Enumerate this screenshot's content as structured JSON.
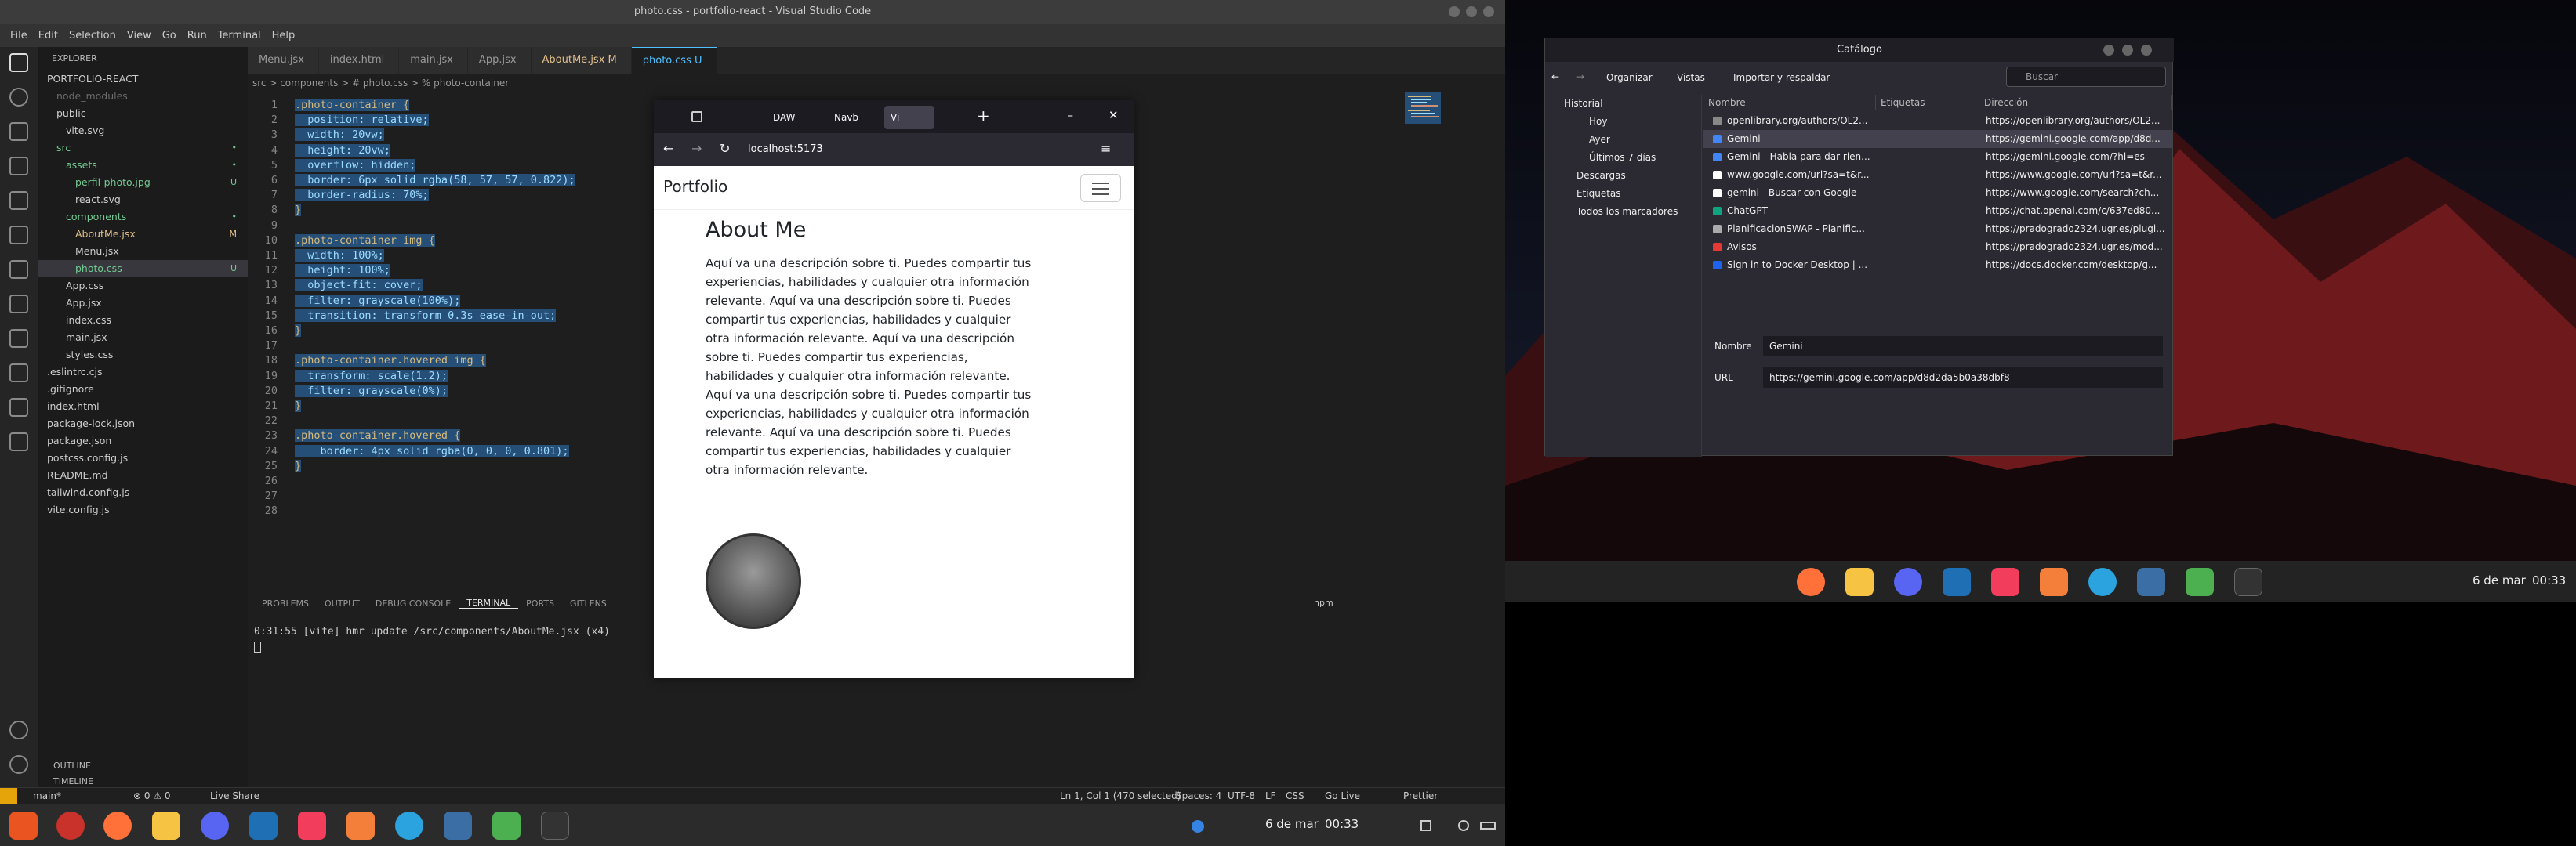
{
  "vscode": {
    "title": "photo.css - portfolio-react - Visual Studio Code",
    "menu": [
      "File",
      "Edit",
      "Selection",
      "View",
      "Go",
      "Run",
      "Terminal",
      "Help"
    ],
    "explorer_header": "EXPLORER",
    "tree": [
      {
        "label": "PORTFOLIO-REACT",
        "badge": "",
        "color": "#cccccc"
      },
      {
        "label": "node_modules",
        "badge": "",
        "color": "#6b6b6b"
      },
      {
        "label": "public",
        "badge": "",
        "color": "#cccccc"
      },
      {
        "label": "vite.svg",
        "badge": "",
        "color": "#cccccc"
      },
      {
        "label": "src",
        "badge": "•",
        "color": "#73c991"
      },
      {
        "label": "assets",
        "badge": "•",
        "color": "#73c991"
      },
      {
        "label": "perfil-photo.jpg",
        "badge": "U",
        "color": "#73c991"
      },
      {
        "label": "react.svg",
        "badge": "",
        "color": "#cccccc"
      },
      {
        "label": "components",
        "badge": "•",
        "color": "#73c991"
      },
      {
        "label": "AboutMe.jsx",
        "badge": "M",
        "color": "#e2c08d"
      },
      {
        "label": "Menu.jsx",
        "badge": "",
        "color": "#cccccc"
      },
      {
        "label": "photo.css",
        "badge": "U",
        "color": "#73c991"
      },
      {
        "label": "App.css",
        "badge": "",
        "color": "#cccccc"
      },
      {
        "label": "App.jsx",
        "badge": "",
        "color": "#cccccc"
      },
      {
        "label": "index.css",
        "badge": "",
        "color": "#cccccc"
      },
      {
        "label": "main.jsx",
        "badge": "",
        "color": "#cccccc"
      },
      {
        "label": "styles.css",
        "badge": "",
        "color": "#cccccc"
      },
      {
        "label": ".eslintrc.cjs",
        "badge": "",
        "color": "#cccccc"
      },
      {
        "label": ".gitignore",
        "badge": "",
        "color": "#cccccc"
      },
      {
        "label": "index.html",
        "badge": "",
        "color": "#cccccc"
      },
      {
        "label": "package-lock.json",
        "badge": "",
        "color": "#cccccc"
      },
      {
        "label": "package.json",
        "badge": "",
        "color": "#cccccc"
      },
      {
        "label": "postcss.config.js",
        "badge": "",
        "color": "#cccccc"
      },
      {
        "label": "README.md",
        "badge": "",
        "color": "#cccccc"
      },
      {
        "label": "tailwind.config.js",
        "badge": "",
        "color": "#cccccc"
      },
      {
        "label": "vite.config.js",
        "badge": "",
        "color": "#cccccc"
      }
    ],
    "tabs": [
      "Menu.jsx",
      "index.html",
      "main.jsx",
      "App.jsx",
      "AboutMe.jsx M",
      "photo.css U"
    ],
    "breadcrumb": "src > components > # photo.css > % photo-container",
    "code_lines": [
      ".photo-container {",
      "  position: relative;",
      "  width: 20vw;",
      "  height: 20vw;",
      "  overflow: hidden;",
      "  border: 6px solid rgba(58, 57, 57, 0.822);",
      "  border-radius: 70%;",
      "}",
      "",
      ".photo-container img {",
      "  width: 100%;",
      "  height: 100%;",
      "  object-fit: cover;",
      "  filter: grayscale(100%);",
      "  transition: transform 0.3s ease-in-out;",
      "}",
      "",
      ".photo-container.hovered img {",
      "  transform: scale(1.2);",
      "  filter: grayscale(0%);",
      "}",
      "",
      ".photo-container.hovered {",
      "    border: 4px solid rgba(0, 0, 0, 0.801);",
      "}",
      "",
      "",
      ""
    ],
    "panel_tabs": [
      "PROBLEMS",
      "OUTPUT",
      "DEBUG CONSOLE",
      "TERMINAL",
      "PORTS",
      "GITLENS"
    ],
    "panel_shell": "npm",
    "terminal_line": "0:31:55 [vite] hmr update /src/components/AboutMe.jsx (x4)",
    "outline": "OUTLINE",
    "timeline": "TIMELINE",
    "status": {
      "branch": "main*",
      "errors": "⊗ 0 ⚠ 0",
      "live_share": "Live Share",
      "position": "Ln 1, Col 1 (470 selected)",
      "spaces": "Spaces: 4",
      "encoding": "UTF-8",
      "eol": "LF",
      "language": "CSS",
      "go_live": "Go Live",
      "prettier": "Prettier"
    }
  },
  "firefox": {
    "tabs": [
      "DAW",
      "Navb",
      "Vi"
    ],
    "url": "localhost:5173",
    "brand": "Portfolio",
    "about_title": "About Me",
    "about_text": "Aquí va una descripción sobre ti. Puedes compartir tus experiencias, habilidades y cualquier otra información relevante. Aquí va una descripción sobre ti. Puedes compartir tus experiencias, habilidades y cualquier otra información relevante. Aquí va una descripción sobre ti. Puedes compartir tus experiencias, habilidades y cualquier otra información relevante. Aquí va una descripción sobre ti. Puedes compartir tus experiencias, habilidades y cualquier otra información relevante. Aquí va una descripción sobre ti. Puedes compartir tus experiencias, habilidades y cualquier otra información relevante."
  },
  "library": {
    "title": "Catálogo",
    "toolbar": {
      "organize": "Organizar",
      "views": "Vistas",
      "import": "Importar y respaldar",
      "search_placeholder": "Buscar"
    },
    "sidebar": [
      "Historial",
      "Hoy",
      "Ayer",
      "Últimos 7 días",
      "Descargas",
      "Etiquetas",
      "Todos los marcadores"
    ],
    "columns": [
      "Nombre",
      "Etiquetas",
      "Dirección"
    ],
    "rows": [
      {
        "name": "openlibrary.org/authors/OL2...",
        "url": "https://openlibrary.org/authors/OL2..."
      },
      {
        "name": "Gemini",
        "url": "https://gemini.google.com/app/d8d..."
      },
      {
        "name": "Gemini - Habla para dar rien...",
        "url": "https://gemini.google.com/?hl=es"
      },
      {
        "name": "www.google.com/url?sa=t&r...",
        "url": "https://www.google.com/url?sa=t&r..."
      },
      {
        "name": "gemini - Buscar con Google",
        "url": "https://www.google.com/search?ch..."
      },
      {
        "name": "ChatGPT",
        "url": "https://chat.openai.com/c/637ed80..."
      },
      {
        "name": "PlanificacionSWAP - Planific...",
        "url": "https://pradogrado2324.ugr.es/plugi..."
      },
      {
        "name": "Avisos",
        "url": "https://pradogrado2324.ugr.es/mod..."
      },
      {
        "name": "Sign in to Docker Desktop | ...",
        "url": "https://docs.docker.com/desktop/g..."
      }
    ],
    "detail": {
      "name_label": "Nombre",
      "name_value": "Gemini",
      "url_label": "URL",
      "url_value": "https://gemini.google.com/app/d8d2da5b0a38dbf8"
    }
  },
  "taskbar": {
    "date": "6 de mar",
    "time": "00:33"
  },
  "colors": {
    "accent": "#4fc1ff",
    "editor_bg": "#1e1e1e",
    "added": "#73c991",
    "modified": "#e2c08d"
  }
}
